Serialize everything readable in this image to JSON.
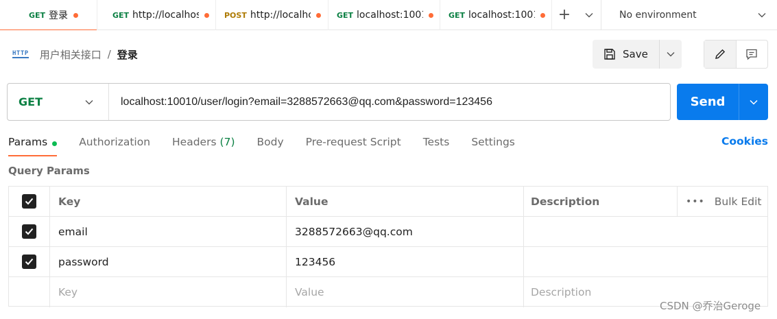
{
  "tabs": [
    {
      "method": "GET",
      "title": "登录",
      "active": true
    },
    {
      "method": "GET",
      "title": "http://localhos"
    },
    {
      "method": "POST",
      "title": "http://localhc"
    },
    {
      "method": "GET",
      "title": "localhost:1001"
    },
    {
      "method": "GET",
      "title": "localhost:1001"
    }
  ],
  "environment": {
    "label": "No environment"
  },
  "breadcrumb": {
    "icon_text": "HTTP",
    "parent": "用户相关接口",
    "separator": "/",
    "current": "登录"
  },
  "toolbar": {
    "save_label": "Save"
  },
  "request": {
    "method": "GET",
    "url": "localhost:10010/user/login?email=3288572663@qq.com&password=123456",
    "send_label": "Send"
  },
  "request_tabs": {
    "params": "Params",
    "authorization": "Authorization",
    "headers": "Headers",
    "headers_count": "(7)",
    "body": "Body",
    "pre_request_script": "Pre-request Script",
    "tests": "Tests",
    "settings": "Settings",
    "cookies": "Cookies"
  },
  "query_params": {
    "title": "Query Params",
    "headers": {
      "key": "Key",
      "value": "Value",
      "description": "Description",
      "bulk_edit": "Bulk Edit",
      "more": "•••"
    },
    "rows": [
      {
        "checked": true,
        "key": "email",
        "value": "3288572663@qq.com",
        "description": ""
      },
      {
        "checked": true,
        "key": "password",
        "value": "123456",
        "description": ""
      }
    ],
    "placeholders": {
      "key": "Key",
      "value": "Value",
      "description": "Description"
    }
  },
  "watermark": "CSDN @乔治Geroge",
  "colors": {
    "accent": "#ff6c37",
    "get": "#0b8043",
    "post": "#ad7a03",
    "send": "#097bed",
    "active_dot": "#0cbb52"
  }
}
